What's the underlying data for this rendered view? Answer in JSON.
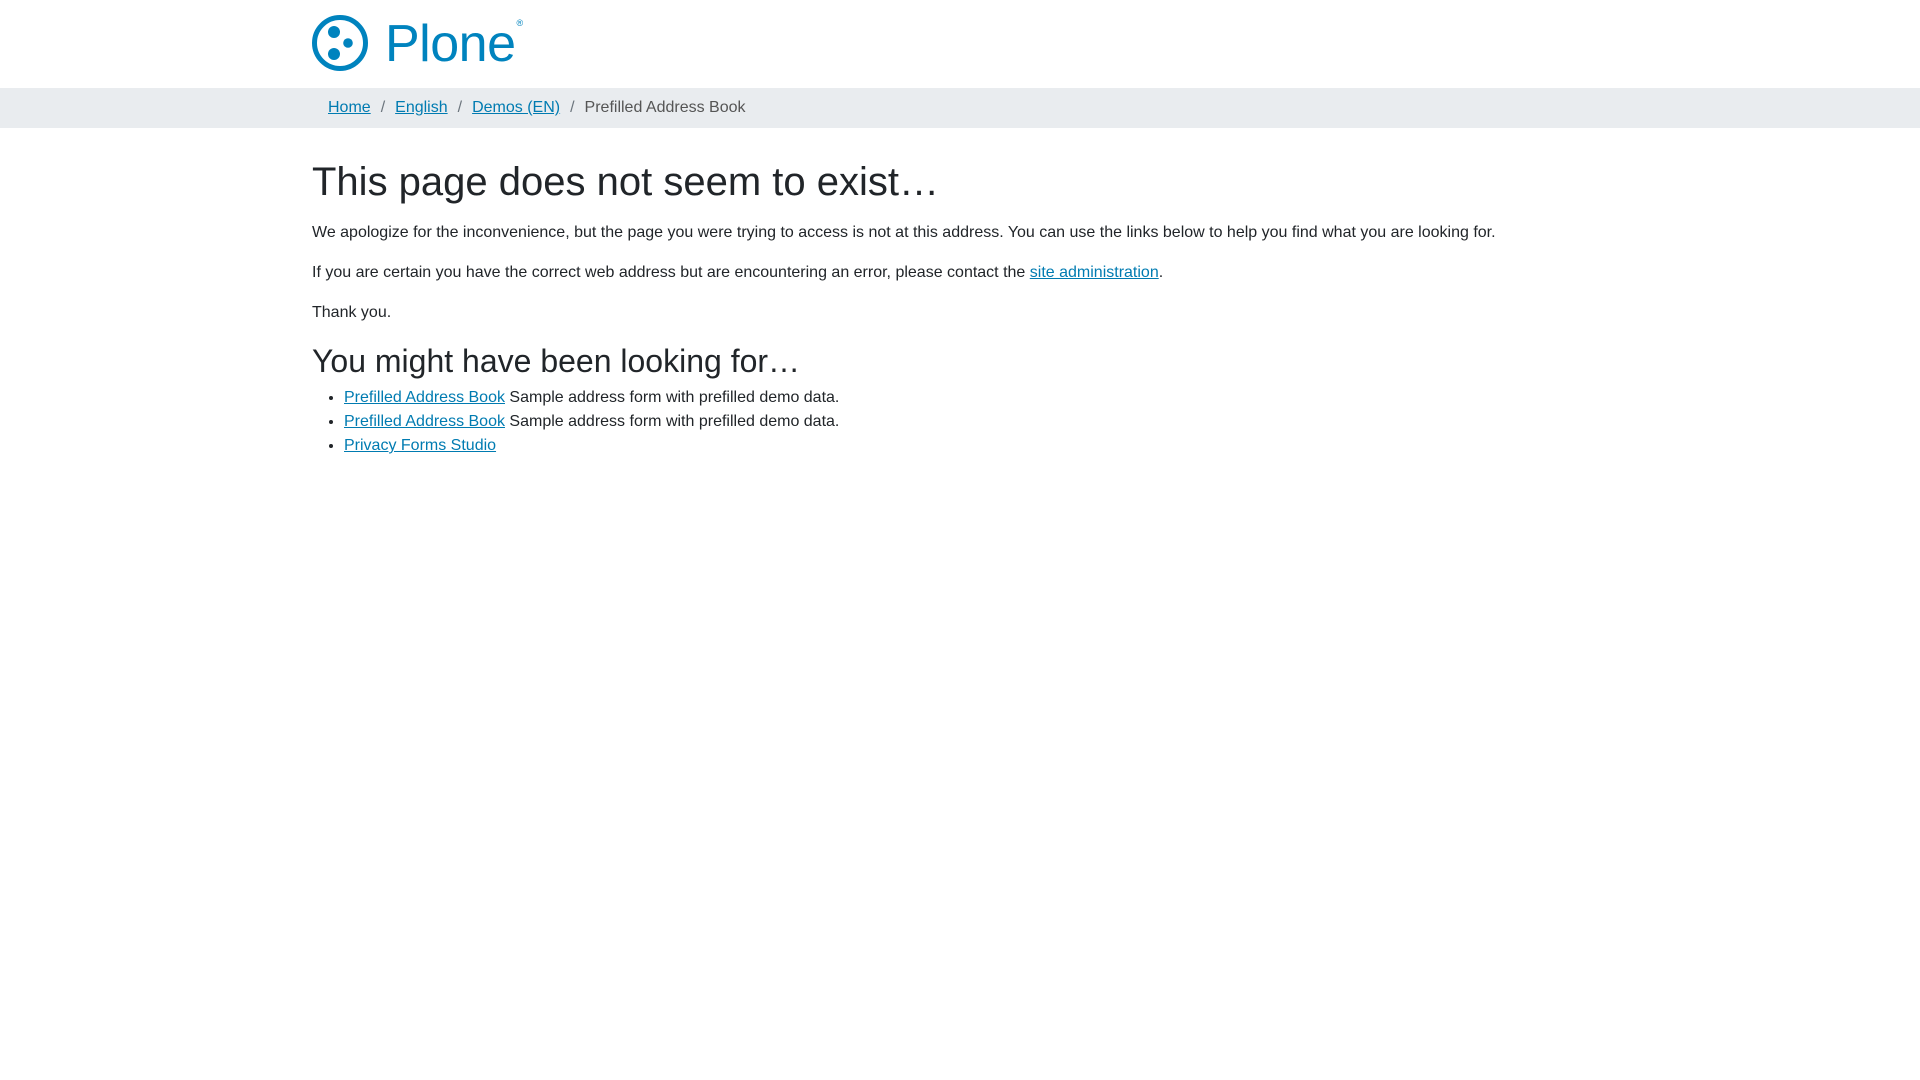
{
  "site": {
    "logo_text": "Plone",
    "logo_mark": "®",
    "brand_color": "#0083be"
  },
  "breadcrumb": {
    "items": [
      {
        "label": "Home"
      },
      {
        "label": "English"
      },
      {
        "label": "Demos (EN)"
      }
    ],
    "separator": "/",
    "current": "Prefilled Address Book"
  },
  "main": {
    "title": "This page does not seem to exist…",
    "apology": "We apologize for the inconvenience, but the page you were trying to access is not at this address. You can use the links below to help you find what you are looking for.",
    "contact_prefix": "If you are certain you have the correct web address but are encountering an error, please contact the ",
    "contact_link": "site administration",
    "contact_suffix": ".",
    "thanks": "Thank you.",
    "suggestions_heading": "You might have been looking for…",
    "suggestions": [
      {
        "title": "Prefilled Address Book",
        "description": " Sample address form with prefilled demo data."
      },
      {
        "title": "Prefilled Address Book",
        "description": " Sample address form with prefilled demo data."
      },
      {
        "title": "Privacy Forms Studio",
        "description": ""
      }
    ]
  }
}
